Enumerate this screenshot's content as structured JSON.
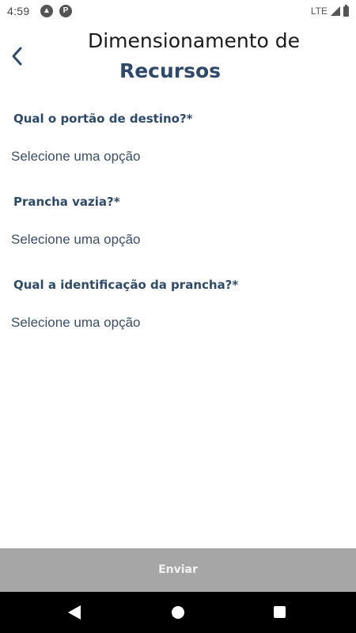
{
  "status_bar": {
    "time": "4:59",
    "network": "LTE",
    "icons": [
      "app-a-icon",
      "app-p-icon",
      "signal-icon",
      "battery-icon"
    ]
  },
  "header": {
    "back_icon": "chevron-left-icon",
    "title": "Dimensionamento de",
    "subtitle": "Recursos"
  },
  "form": {
    "questions": [
      {
        "label": "Qual o portão de destino?*",
        "placeholder": "Selecione uma opção"
      },
      {
        "label": "Prancha vazia?*",
        "placeholder": "Selecione uma opção"
      },
      {
        "label": "Qual a identificação da prancha?*",
        "placeholder": "Selecione uma opção"
      }
    ]
  },
  "submit": {
    "label": "Enviar"
  },
  "nav_bar": {
    "icons": [
      "back-triangle-icon",
      "home-circle-icon",
      "recents-square-icon"
    ]
  },
  "colors": {
    "accent": "#2f4a68",
    "submit_background": "#a6a6a6",
    "nav_background": "#000000"
  }
}
